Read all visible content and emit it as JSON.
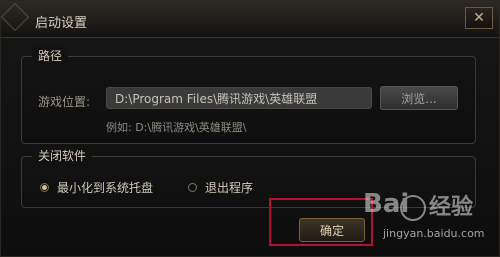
{
  "window": {
    "title": "启动设置",
    "close_symbol": "✕"
  },
  "path_section": {
    "title": "路径",
    "label": "游戏位置:",
    "value": "D:\\Program Files\\腾讯游戏\\英雄联盟",
    "browse_label": "浏览...",
    "example": "例如: D:\\腾讯游戏\\英雄联盟\\"
  },
  "close_software_section": {
    "title": "关闭软件",
    "options": [
      {
        "label": "最小化到系统托盘",
        "checked": true
      },
      {
        "label": "退出程序",
        "checked": false
      }
    ]
  },
  "buttons": {
    "confirm": "确定"
  },
  "watermark": {
    "left": "Bai",
    "right": "经验",
    "url": "jingyan.baidu.com"
  },
  "colors": {
    "highlight_border": "#b1102f"
  }
}
